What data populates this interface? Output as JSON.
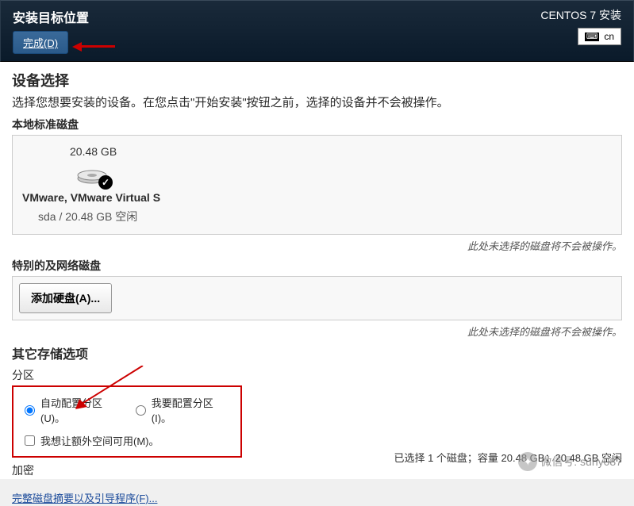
{
  "header": {
    "title": "安装目标位置",
    "done_button": "完成(D)",
    "installer": "CENTOS 7 安装",
    "lang": "cn"
  },
  "device_selection": {
    "title": "设备选择",
    "description": "选择您想要安装的设备。在您点击\"开始安装\"按钮之前，选择的设备并不会被操作。"
  },
  "local_disks": {
    "label": "本地标准磁盘",
    "disk": {
      "size": "20.48 GB",
      "name": "VMware, VMware Virtual S",
      "details": "sda   /   20.48 GB 空闲"
    },
    "note": "此处未选择的磁盘将不会被操作。"
  },
  "network_disks": {
    "label": "特别的及网络磁盘",
    "add_button": "添加硬盘(A)...",
    "note": "此处未选择的磁盘将不会被操作。"
  },
  "storage_options": {
    "title": "其它存储选项",
    "partition_label": "分区",
    "auto_partition": "自动配置分区(U)。",
    "manual_partition": "我要配置分区(I)。",
    "extra_space": "我想让额外空间可用(M)。",
    "encryption_label": "加密"
  },
  "footer": {
    "summary_link": "完整磁盘摘要以及引导程序(F)...",
    "status": "已选择 1 个磁盘；容量 20.48 GB；20.48 GB 空闲"
  },
  "watermark": "微信号: suny087"
}
